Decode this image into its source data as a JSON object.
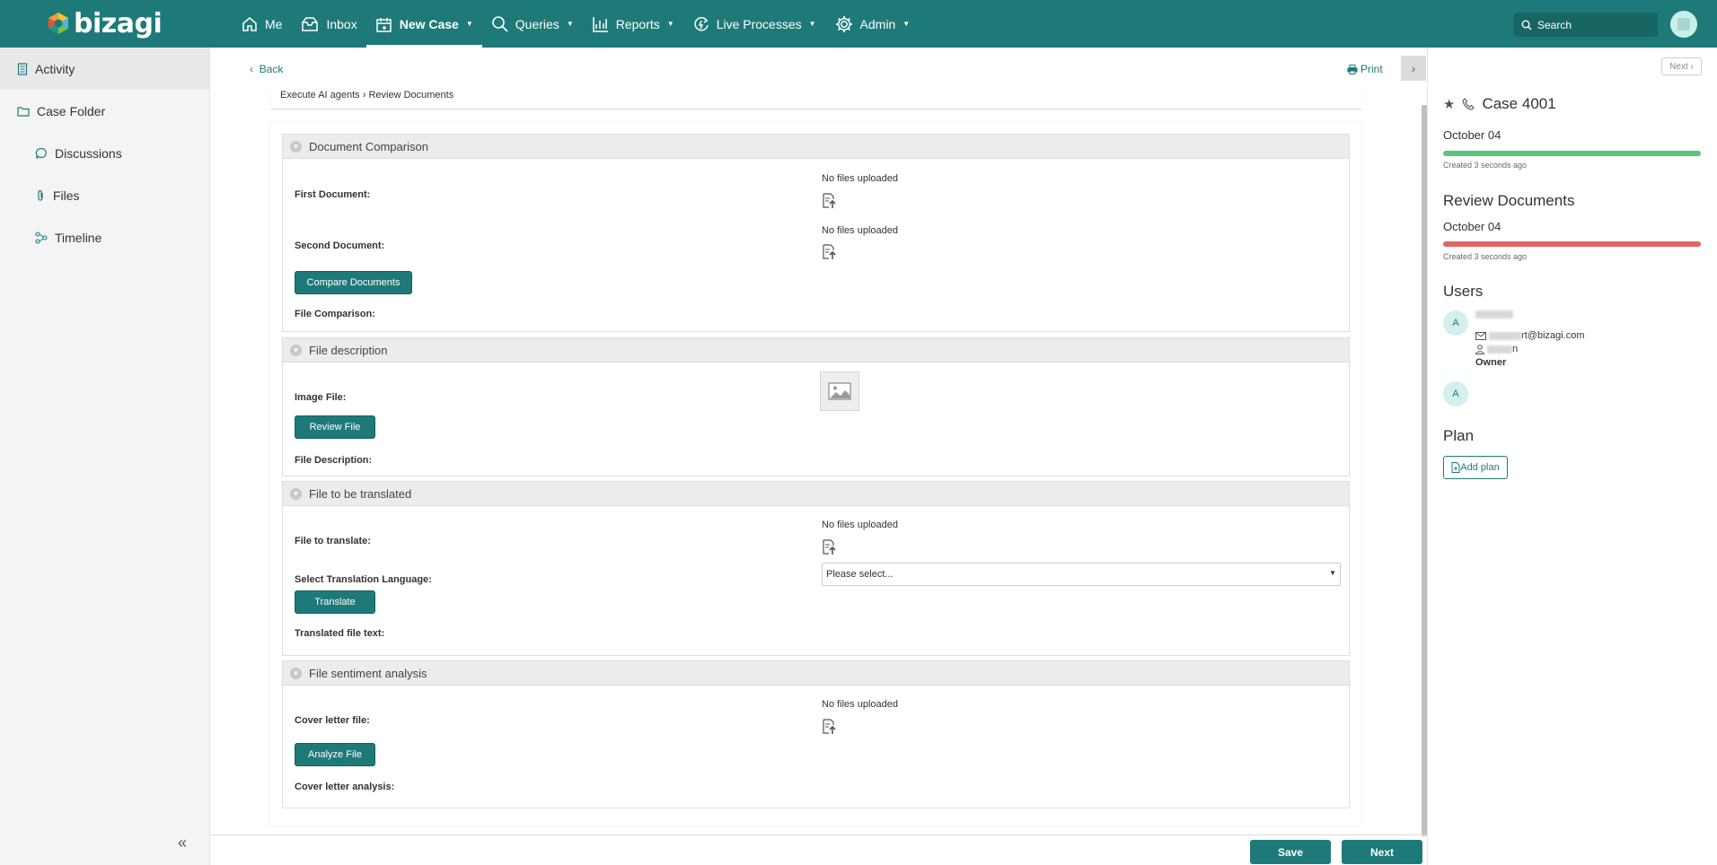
{
  "app": {
    "logo_text": "bizagi",
    "colors": {
      "brand": "#1e7a78",
      "progress_green": "#5cc57a",
      "progress_red": "#e06666"
    }
  },
  "nav": {
    "items": [
      {
        "label": "Me",
        "icon": "home-icon",
        "has_menu": false
      },
      {
        "label": "Inbox",
        "icon": "inbox-icon",
        "has_menu": false
      },
      {
        "label": "New Case",
        "icon": "new-case-icon",
        "has_menu": true
      },
      {
        "label": "Queries",
        "icon": "search-icon",
        "has_menu": true
      },
      {
        "label": "Reports",
        "icon": "chart-icon",
        "has_menu": true
      },
      {
        "label": "Live Processes",
        "icon": "live-process-icon",
        "has_menu": true
      },
      {
        "label": "Admin",
        "icon": "gear-icon",
        "has_menu": true
      }
    ],
    "search_placeholder": "Search"
  },
  "sidebar": {
    "items": [
      {
        "label": "Activity",
        "icon": "activity-icon"
      },
      {
        "label": "Case Folder",
        "icon": "folder-icon"
      },
      {
        "label": "Discussions",
        "icon": "chat-icon"
      },
      {
        "label": "Files",
        "icon": "paperclip-icon"
      },
      {
        "label": "Timeline",
        "icon": "timeline-icon"
      }
    ],
    "collapse_icon": "double-chevron-left-icon"
  },
  "main": {
    "back_label": "Back",
    "print_label": "Print",
    "breadcrumb": "Execute AI agents › Review Documents",
    "groups": {
      "comparison": {
        "title": "Document Comparison",
        "first_label": "First Document:",
        "first_status": "No files uploaded",
        "second_label": "Second Document:",
        "second_status": "No files uploaded",
        "button": "Compare Documents",
        "result_label": "File Comparison:"
      },
      "description": {
        "title": "File description",
        "image_label": "Image File:",
        "button": "Review File",
        "result_label": "File Description:"
      },
      "translate": {
        "title": "File to be translated",
        "file_label": "File to translate:",
        "file_status": "No files uploaded",
        "language_label": "Select Translation Language:",
        "language_value": "Please select...",
        "button": "Translate",
        "result_label": "Translated file text:"
      },
      "sentiment": {
        "title": "File sentiment analysis",
        "file_label": "Cover letter file:",
        "file_status": "No files uploaded",
        "button": "Analyze File",
        "result_label": "Cover letter analysis:"
      }
    },
    "save_label": "Save",
    "next_label": "Next"
  },
  "right_panel": {
    "next_label": "Next",
    "case_title": "Case 4001",
    "case_date": "October 04",
    "case_created": "Created 3 seconds ago",
    "task_title": "Review Documents",
    "task_date": "October 04",
    "task_created": "Created 3 seconds ago",
    "users_heading": "Users",
    "user1_initial": "A",
    "user1_email_suffix": "rt@bizagi.com",
    "user1_role_suffix": "n",
    "user1_role": "Owner",
    "user2_initial": "A",
    "plan_heading": "Plan",
    "add_plan_label": "Add plan"
  }
}
